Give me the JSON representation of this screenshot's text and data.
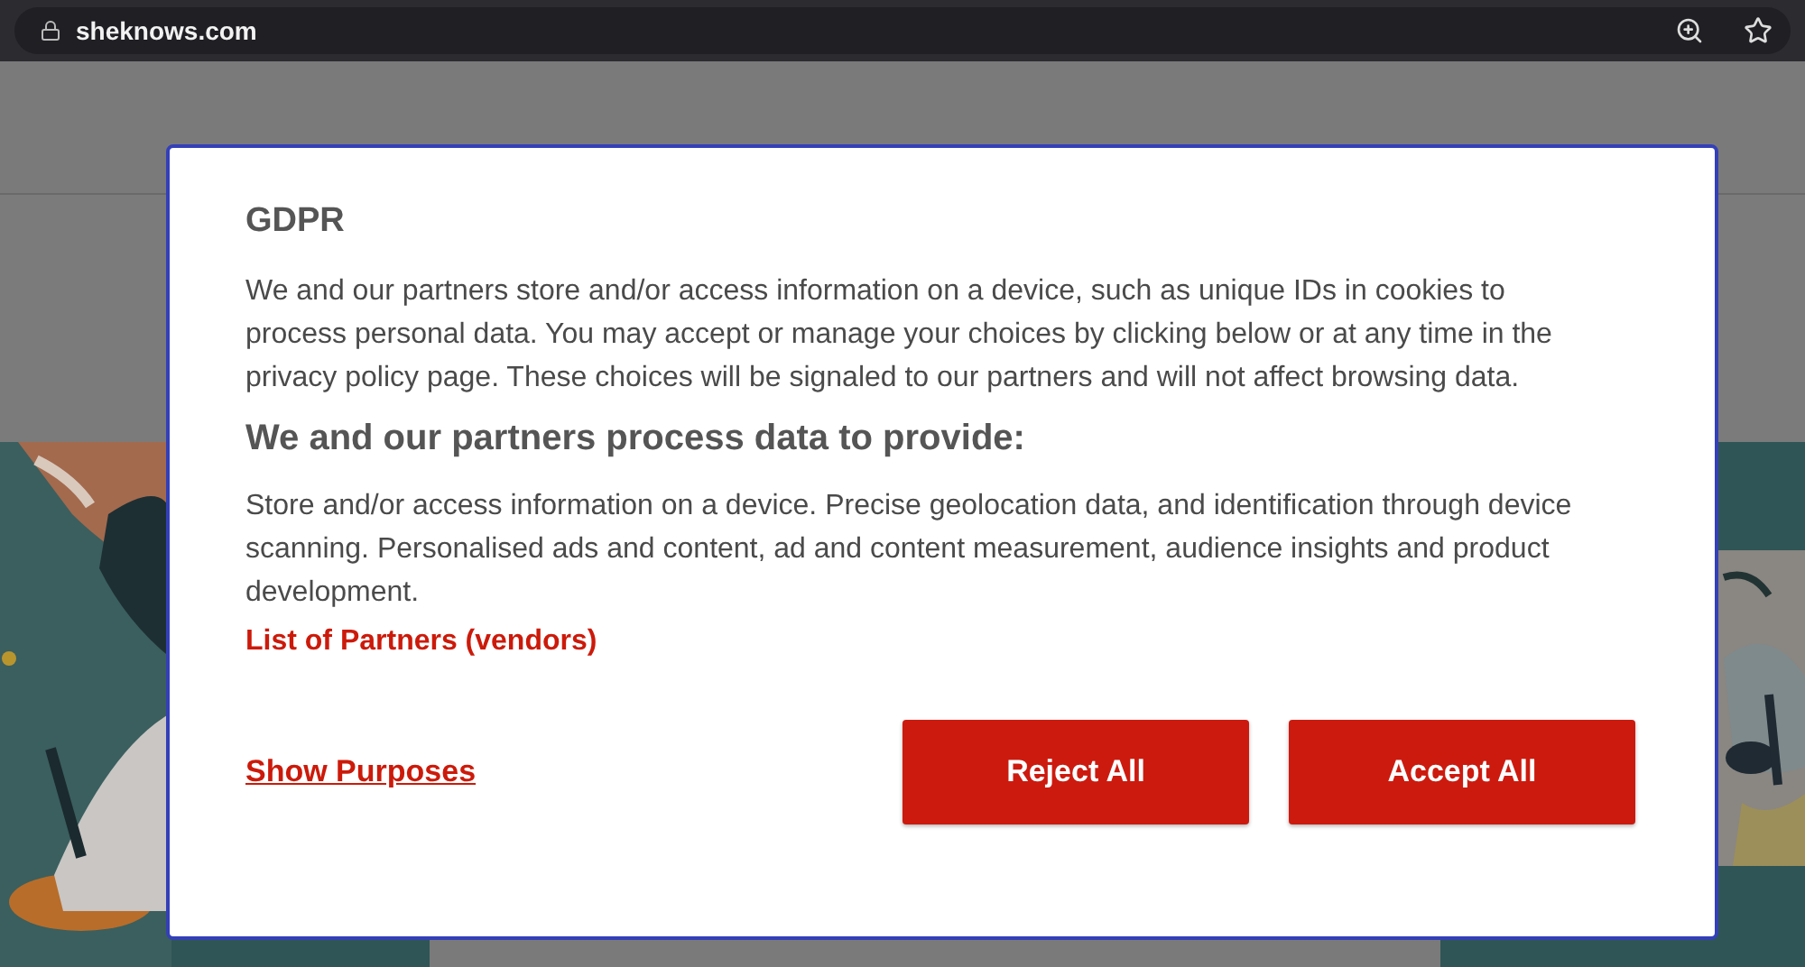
{
  "browser": {
    "url": "sheknows.com"
  },
  "dialog": {
    "title": "GDPR",
    "intro": "We and our partners store and/or access information on a device, such as unique IDs in cookies to process personal data. You may accept or manage your choices by clicking below or at any time in the privacy policy page. These choices will be signaled to our partners and will not affect browsing data.",
    "heading": "We and our partners process data to provide:",
    "purposes": "Store and/or access information on a device. Precise geolocation data, and identification through device scanning. Personalised ads and content, ad and content measurement, audience insights and product development.",
    "partners_link": "List of Partners (vendors)",
    "show_purposes_link": "Show Purposes",
    "buttons": [
      {
        "label": "Reject All"
      },
      {
        "label": "Accept All"
      }
    ]
  }
}
